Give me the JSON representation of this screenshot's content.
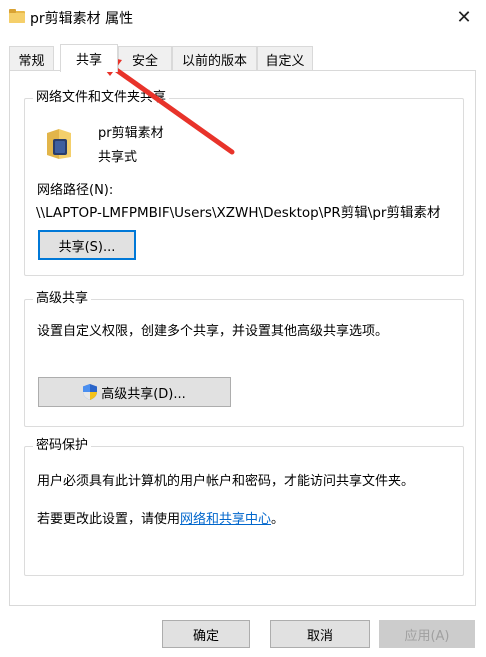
{
  "window": {
    "title": "pr剪辑素材 属性",
    "close_label": "✕"
  },
  "tabs": [
    {
      "label": "常规"
    },
    {
      "label": "共享"
    },
    {
      "label": "安全"
    },
    {
      "label": "以前的版本"
    },
    {
      "label": "自定义"
    }
  ],
  "network_share": {
    "legend": "网络文件和文件夹共享",
    "folder_name": "pr剪辑素材",
    "share_status": "共享式",
    "network_path_label": "网络路径(N):",
    "network_path_value": "\\\\LAPTOP-LMFPMBIF\\Users\\XZWH\\Desktop\\PR剪辑\\pr剪辑素材",
    "share_button": "共享(S)..."
  },
  "advanced_share": {
    "legend": "高级共享",
    "description": "设置自定义权限，创建多个共享，并设置其他高级共享选项。",
    "button": "高级共享(D)..."
  },
  "password_protection": {
    "legend": "密码保护",
    "line1": "用户必须具有此计算机的用户帐户和密码，才能访问共享文件夹。",
    "line2_prefix": "若要更改此设置，请使用",
    "line2_link": "网络和共享中心",
    "line2_suffix": "。"
  },
  "footer": {
    "ok": "确定",
    "cancel": "取消",
    "apply": "应用(A)"
  },
  "colors": {
    "accent": "#0078d7",
    "link": "#0066cc",
    "annotation_arrow": "#e8332a"
  }
}
